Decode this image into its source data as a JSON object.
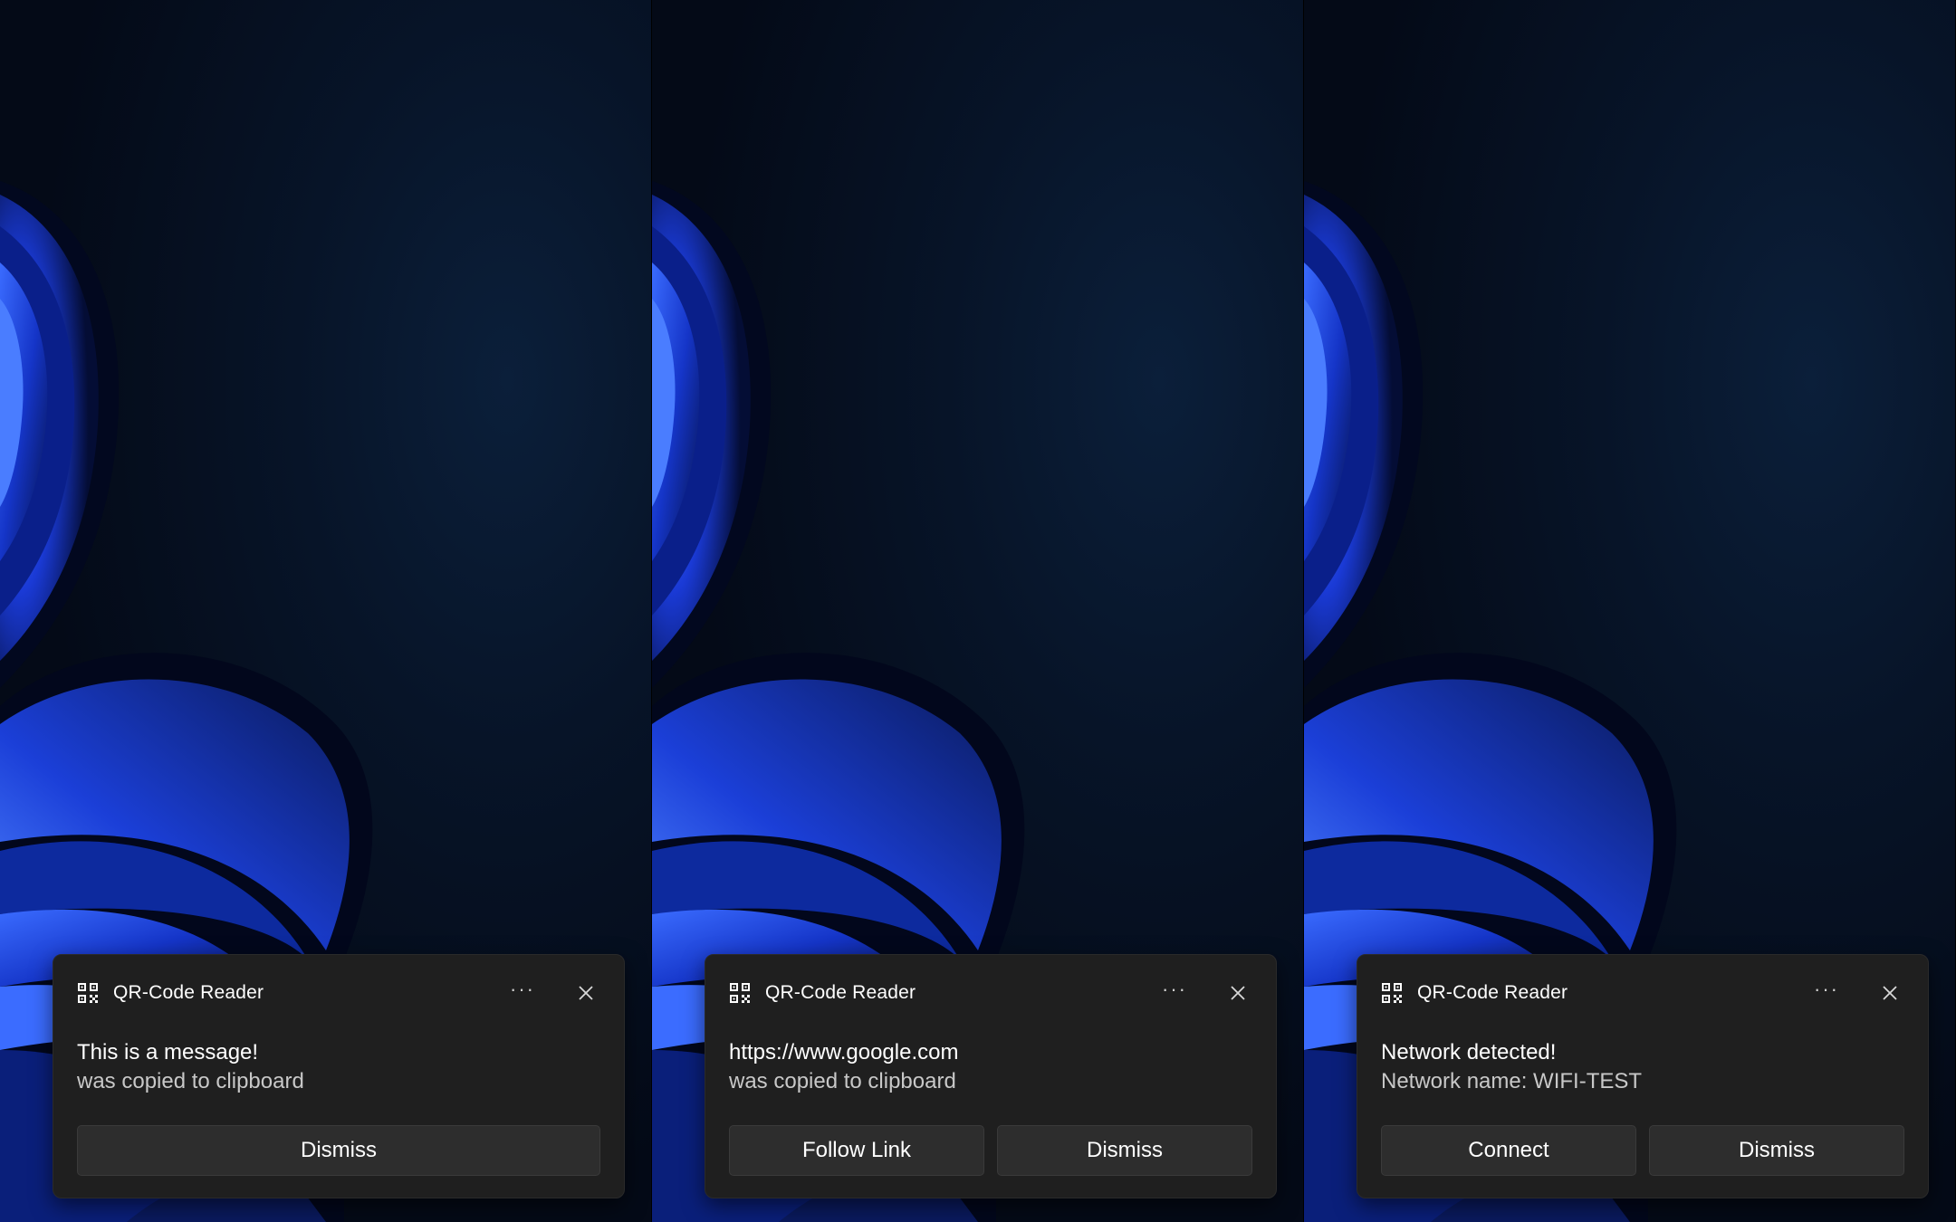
{
  "app": {
    "name": "QR-Code Reader",
    "icon": "qr-code-icon"
  },
  "colors": {
    "toast_background": "#1f1f1f",
    "button_background": "#2d2d2d",
    "wallpaper_accent": "#1e4dff",
    "wallpaper_dark": "#040a17"
  },
  "icons": {
    "more": "more-options-icon",
    "close": "close-icon"
  },
  "header_more_glyph": "···",
  "notifications": [
    {
      "primary": "This is a message!",
      "secondary": "was copied to clipboard",
      "actions": [
        "Dismiss"
      ]
    },
    {
      "primary": "https://www.google.com",
      "secondary": "was copied to clipboard",
      "actions": [
        "Follow Link",
        "Dismiss"
      ]
    },
    {
      "primary": "Network detected!",
      "secondary": "Network name: WIFI-TEST",
      "actions": [
        "Connect",
        "Dismiss"
      ]
    }
  ]
}
